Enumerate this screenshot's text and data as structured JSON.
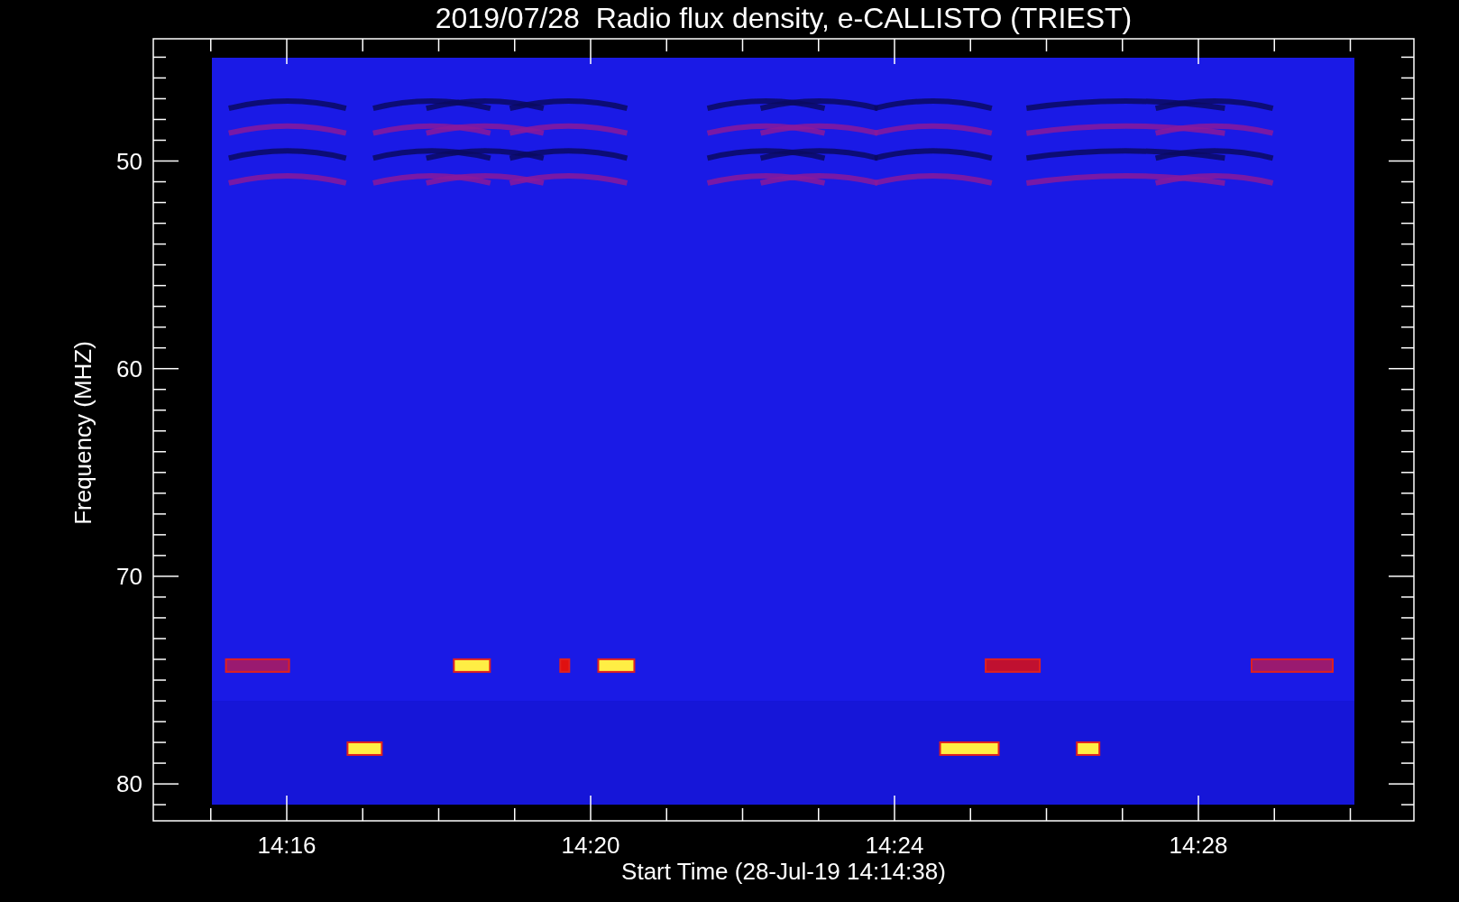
{
  "title": "2019/07/28  Radio flux density, e-CALLISTO (TRIEST)",
  "y_axis": {
    "label": "Frequency (MHZ)",
    "ticks": [
      "50",
      "60",
      "70",
      "80"
    ]
  },
  "x_axis": {
    "label": "Start Time (28-Jul-19 14:14:38)",
    "ticks": [
      "14:16",
      "14:20",
      "14:24",
      "14:28"
    ]
  }
}
